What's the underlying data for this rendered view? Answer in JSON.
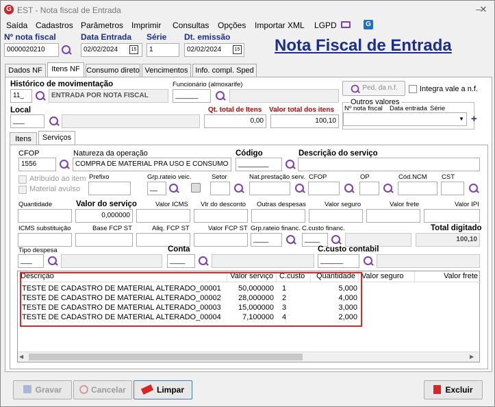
{
  "window": {
    "title": "EST - Nota fiscal de Entrada",
    "logo": "G"
  },
  "menu": [
    "Saída",
    "Cadastros",
    "Parâmetros",
    "Imprimir",
    "Consultas",
    "Opções",
    "Importar XML",
    "LGPD"
  ],
  "header": {
    "nota_fiscal_label": "Nº nota fiscal",
    "nota_fiscal_value": "0000020210",
    "data_entrada_label": "Data Entrada",
    "data_entrada_value": "02/02/2024",
    "serie_label": "Série",
    "serie_value": "1",
    "dt_emissao_label": "Dt. emissão",
    "dt_emissao_value": "02/02/2024",
    "calendar_glyph": "15",
    "big_title": "Nota Fiscal de Entrada"
  },
  "tabs": [
    "Dados NF",
    "Itens NF",
    "Consumo direto",
    "Vencimentos",
    "Info. compl. Sped"
  ],
  "itens": {
    "historico_label": "Histórico de movimentação",
    "historico_code": "11_",
    "historico_desc": "ENTRADA POR NOTA FISCAL",
    "funcionario_label": "Funcionário (almoxarife)",
    "funcionario_value": "______",
    "ped_button": "Ped. da n.f.",
    "integra_label": "Integra vale a n.f.",
    "local_label": "Local",
    "local_value": "___",
    "qt_total_label": "Qt. total de Itens",
    "qt_total_value": "0,00",
    "valor_total_label": "Valor total dos itens",
    "valor_total_value": "100,10",
    "outros_label": "Outros valores",
    "outros_cols": [
      "Nº nota fiscal",
      "Data entrada",
      "Série"
    ],
    "plus": "+"
  },
  "subtabs": [
    "Itens",
    "Serviços"
  ],
  "servicos": {
    "cfop_label": "CFOP",
    "cfop_value": "1556",
    "natureza_label": "Natureza da operação",
    "natureza_value": "COMPRA DE MATERIAL PRA USO E CONSUMO",
    "codigo_label": "Código",
    "codigo_value": "________",
    "descricao_label": "Descrição do serviço",
    "atribuido_label": "Atribuido ao item",
    "avulso_label": "Material avulso",
    "prefixo_label": "Prefixo",
    "grp_rateio_label": "Grp.rateio veic.",
    "grp_rateio_value": "__",
    "setor_label": "Setor",
    "nat_prest_label": "Nat.prestação serv.",
    "cfop2_label": "CFOP",
    "op_label": "OP",
    "cod_ncm_label": "Cód.NCM",
    "cst_label": "CST",
    "quantidade_label": "Quantidade",
    "valor_servico_label": "Valor do serviço",
    "valor_servico_value": "0,000000",
    "valor_icms_label": "Valor ICMS",
    "vlr_desconto_label": "Vlr do desconto",
    "outras_desp_label": "Outras despesas",
    "valor_seguro_label": "Valor seguro",
    "valor_frete_label": "Valor frete",
    "valor_ipi_label": "Valor IPI",
    "icms_subst_label": "ICMS substituição",
    "base_fcp_label": "Base FCP ST",
    "aliq_fcp_label": "Aliq. FCP ST",
    "valor_fcp_label": "Valor FCP ST",
    "grp_financ_label": "Grp.rateio financ.",
    "grp_financ_value": "____",
    "ccusto_financ_label": "C.custo financ.",
    "ccusto_financ_value": "____",
    "total_digitado_label": "Total digitado",
    "total_digitado_value": "100,10",
    "tipo_despesa_label": "Tipo despesa",
    "tipo_despesa_value": "___",
    "conta_label": "Conta",
    "conta_value": "____",
    "ccusto_contabil_label": "C.custo contabil",
    "ccusto_contabil_value": "______"
  },
  "grid": {
    "columns": [
      "Descrição",
      "Valor serviço",
      "C.custo",
      "Quantidade",
      "Valor seguro",
      "Valor frete"
    ],
    "rows": [
      {
        "descricao": "TESTE DE CADASTRO DE MATERIAL ALTERADO_00001",
        "valor": "50,000000",
        "ccusto": "1",
        "qtd": "5,000"
      },
      {
        "descricao": "TESTE DE CADASTRO DE MATERIAL ALTERADO_00002",
        "valor": "28,000000",
        "ccusto": "2",
        "qtd": "4,000"
      },
      {
        "descricao": "TESTE DE CADASTRO DE MATERIAL ALTERADO_00003",
        "valor": "15,000000",
        "ccusto": "3",
        "qtd": "3,000"
      },
      {
        "descricao": "TESTE DE CADASTRO DE MATERIAL ALTERADO_00004",
        "valor": "7,100000",
        "ccusto": "4",
        "qtd": "2,000"
      }
    ],
    "highlight_color": "#d62828"
  },
  "buttons": {
    "gravar": "Gravar",
    "cancelar": "Cancelar",
    "limpar": "Limpar",
    "excluir": "Excluir"
  }
}
